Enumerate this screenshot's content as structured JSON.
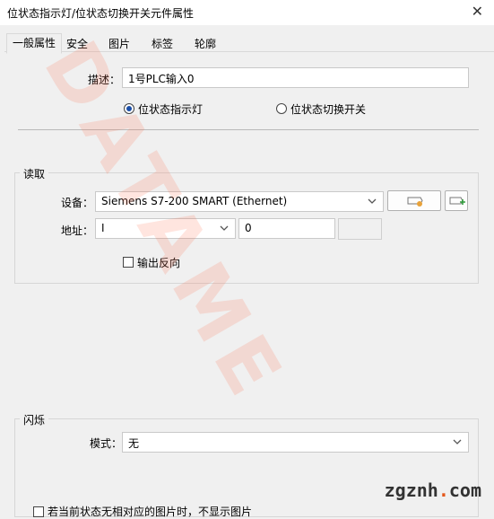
{
  "window": {
    "title": "位状态指示灯/位状态切换开关元件属性",
    "close_glyph": "✕"
  },
  "tabs": [
    {
      "label": "一般属性",
      "active": true
    },
    {
      "label": "安全"
    },
    {
      "label": "图片"
    },
    {
      "label": "标签"
    },
    {
      "label": "轮廓"
    }
  ],
  "description": {
    "label": "描述：",
    "value": "1号PLC输入0"
  },
  "type_radios": [
    {
      "label": "位状态指示灯",
      "selected": true
    },
    {
      "label": "位状态切换开关",
      "selected": false
    }
  ],
  "read_group": {
    "title": "读取",
    "device_label": "设备：",
    "device_value": "Siemens S7-200 SMART (Ethernet)",
    "address_label": "地址：",
    "address_type": "I",
    "address_value": "0",
    "invert_label": "输出反向"
  },
  "blink_group": {
    "title": "闪烁",
    "mode_label": "模式：",
    "mode_value": "无"
  },
  "bottom_option": {
    "label": "若当前状态无相对应的图片时，不显示图片"
  },
  "watermark": {
    "text": "DATAME",
    "color": "#ff6e50"
  },
  "site_logo": {
    "part1": "zgznh",
    "part2": ".",
    "part3": "com",
    "accent": "#e3571a"
  }
}
